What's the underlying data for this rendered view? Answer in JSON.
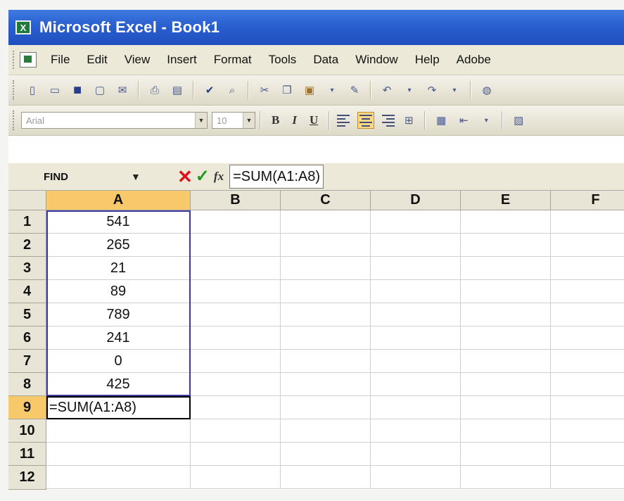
{
  "window": {
    "title": "Microsoft Excel - Book1"
  },
  "menu": [
    "File",
    "Edit",
    "View",
    "Insert",
    "Format",
    "Tools",
    "Data",
    "Window",
    "Help",
    "Adobe"
  ],
  "format_toolbar": {
    "font": "Arial",
    "size": "10",
    "bold": "B",
    "italic": "I",
    "underline": "U"
  },
  "formula_bar": {
    "name_box": "FIND",
    "formula": "=SUM(A1:A8)"
  },
  "sheet": {
    "columns": [
      "A",
      "B",
      "C",
      "D",
      "E",
      "F"
    ],
    "rows": [
      "1",
      "2",
      "3",
      "4",
      "5",
      "6",
      "7",
      "8",
      "9",
      "10",
      "11",
      "12"
    ],
    "column_a_values": [
      "541",
      "265",
      "21",
      "89",
      "789",
      "241",
      "0",
      "425",
      "=SUM(A1:A8)"
    ]
  }
}
